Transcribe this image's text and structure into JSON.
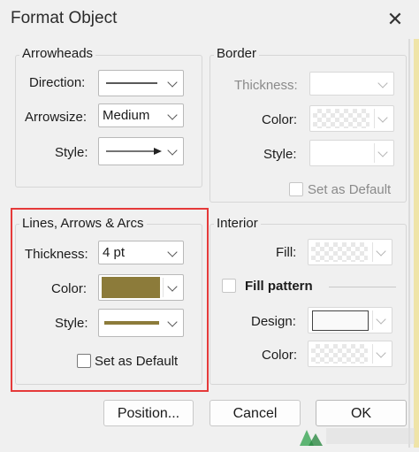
{
  "window": {
    "title": "Format Object"
  },
  "arrowheads": {
    "label": "Arrowheads",
    "direction_label": "Direction:",
    "arrowsize_label": "Arrowsize:",
    "arrowsize_value": "Medium",
    "style_label": "Style:"
  },
  "border": {
    "label": "Border",
    "thickness_label": "Thickness:",
    "color_label": "Color:",
    "style_label": "Style:",
    "default_label": "Set as Default"
  },
  "lines": {
    "label": "Lines, Arrows & Arcs",
    "thickness_label": "Thickness:",
    "thickness_value": "4 pt",
    "color_label": "Color:",
    "color_hex": "#8c7b3a",
    "style_label": "Style:",
    "default_label": "Set as Default"
  },
  "interior": {
    "label": "Interior",
    "fill_label": "Fill:",
    "fill_pattern_label": "Fill pattern",
    "design_label": "Design:",
    "color_label": "Color:"
  },
  "buttons": {
    "position": "Position...",
    "cancel": "Cancel",
    "ok": "OK"
  },
  "colors": {
    "highlight": "#e53a3a",
    "line_color": "#8c7b3a"
  }
}
